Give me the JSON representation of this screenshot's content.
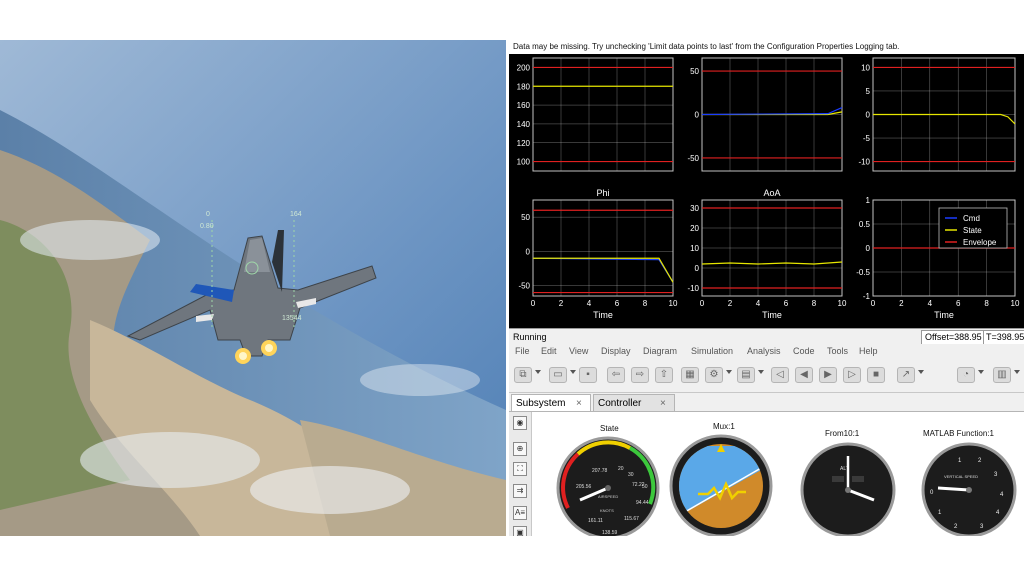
{
  "scope": {
    "warning": "Data may be missing.  Try unchecking 'Limit data points to last' from the Configuration Properties Logging tab.",
    "status": "Running",
    "offset": "Offset=388.95",
    "time": "T=398.950",
    "grid_color": "#d0d0d0",
    "envelope_color": "#e02020",
    "state_color": "#e6e600",
    "cmd_color": "#1a3cff",
    "legend": [
      "Cmd",
      "State",
      "Envelope"
    ],
    "plots": [
      {
        "title": "",
        "xticks": [
          "",
          "",
          "",
          "",
          "",
          ""
        ],
        "yticks": [
          "200",
          "180",
          "160",
          "140",
          "120",
          "100"
        ],
        "xlabel": ""
      },
      {
        "title": "",
        "xticks": [
          "",
          "",
          "",
          "",
          "",
          ""
        ],
        "yticks": [
          "50",
          "0",
          "-50"
        ],
        "xlabel": ""
      },
      {
        "title": "",
        "xticks": [
          "",
          "",
          "",
          "",
          "",
          ""
        ],
        "yticks": [
          "10",
          "5",
          "0",
          "-5",
          "-10"
        ],
        "xlabel": ""
      },
      {
        "title": "Phi",
        "xticks": [
          "0",
          "2",
          "4",
          "6",
          "8",
          "10"
        ],
        "yticks": [
          "50",
          "0",
          "-50"
        ],
        "xlabel": "Time"
      },
      {
        "title": "AoA",
        "xticks": [
          "0",
          "2",
          "4",
          "6",
          "8",
          "10"
        ],
        "yticks": [
          "30",
          "20",
          "10",
          "0",
          "-10"
        ],
        "xlabel": "Time"
      },
      {
        "title": "",
        "xticks": [
          "0",
          "2",
          "4",
          "6",
          "8",
          "10"
        ],
        "yticks": [
          "1",
          "0.5",
          "0",
          "-0.5",
          "-1"
        ],
        "xlabel": "Time"
      }
    ]
  },
  "chart_data": [
    {
      "type": "line",
      "title": "",
      "ylim": [
        90,
        210
      ],
      "xlim": [
        0,
        10
      ],
      "series": [
        {
          "name": "Envelope",
          "x": [
            0,
            10
          ],
          "values": [
            200,
            200
          ]
        },
        {
          "name": "Envelope",
          "x": [
            0,
            10
          ],
          "values": [
            100,
            100
          ]
        },
        {
          "name": "State",
          "x": [
            0,
            10
          ],
          "values": [
            180,
            180
          ]
        }
      ]
    },
    {
      "type": "line",
      "title": "",
      "ylim": [
        -65,
        65
      ],
      "xlim": [
        0,
        10
      ],
      "series": [
        {
          "name": "Envelope",
          "x": [
            0,
            10
          ],
          "values": [
            50,
            50
          ]
        },
        {
          "name": "Envelope",
          "x": [
            0,
            10
          ],
          "values": [
            -50,
            -50
          ]
        },
        {
          "name": "State",
          "x": [
            0,
            9,
            10
          ],
          "values": [
            0,
            0,
            3
          ]
        },
        {
          "name": "Cmd",
          "x": [
            0,
            9,
            10
          ],
          "values": [
            0,
            1,
            8
          ]
        }
      ]
    },
    {
      "type": "line",
      "title": "",
      "ylim": [
        -12,
        12
      ],
      "xlim": [
        0,
        10
      ],
      "series": [
        {
          "name": "Envelope",
          "x": [
            0,
            10
          ],
          "values": [
            10,
            10
          ]
        },
        {
          "name": "Envelope",
          "x": [
            0,
            10
          ],
          "values": [
            -10,
            -10
          ]
        },
        {
          "name": "State",
          "x": [
            0,
            9,
            9.5,
            10
          ],
          "values": [
            0,
            0,
            -0.5,
            -2
          ]
        }
      ]
    },
    {
      "type": "line",
      "title": "Phi",
      "xlabel": "Time",
      "ylim": [
        -65,
        75
      ],
      "xlim": [
        0,
        10
      ],
      "series": [
        {
          "name": "Envelope",
          "x": [
            0,
            10
          ],
          "values": [
            60,
            60
          ]
        },
        {
          "name": "Envelope",
          "x": [
            0,
            10
          ],
          "values": [
            -60,
            -60
          ]
        },
        {
          "name": "Cmd",
          "x": [
            0,
            9,
            10
          ],
          "values": [
            -10,
            -12,
            -45
          ]
        },
        {
          "name": "State",
          "x": [
            0,
            9,
            10
          ],
          "values": [
            -10,
            -10,
            -45
          ]
        }
      ]
    },
    {
      "type": "line",
      "title": "AoA",
      "xlabel": "Time",
      "ylim": [
        -14,
        34
      ],
      "xlim": [
        0,
        10
      ],
      "series": [
        {
          "name": "Envelope",
          "x": [
            0,
            10
          ],
          "values": [
            30,
            30
          ]
        },
        {
          "name": "Envelope",
          "x": [
            0,
            10
          ],
          "values": [
            -10,
            -10
          ]
        },
        {
          "name": "State",
          "x": [
            0,
            2,
            4,
            6,
            8,
            9,
            10
          ],
          "values": [
            2,
            2.5,
            2,
            2.5,
            2,
            2.5,
            3
          ]
        }
      ]
    },
    {
      "type": "line",
      "title": "",
      "xlabel": "Time",
      "ylim": [
        -1,
        1
      ],
      "xlim": [
        0,
        10
      ],
      "series": [
        {
          "name": "Envelope",
          "x": [
            0,
            10
          ],
          "values": [
            0,
            0
          ]
        }
      ]
    }
  ],
  "editor": {
    "menu": [
      "File",
      "Edit",
      "View",
      "Display",
      "Diagram",
      "Simulation",
      "Analysis",
      "Code",
      "Tools",
      "Help"
    ],
    "tabs": [
      "Subsystem",
      "Controller"
    ],
    "tab_close": "×",
    "gauges": [
      {
        "title": "State",
        "label": "AIRSPEED",
        "unit": "KNOTS",
        "readouts": [
          "207.78",
          "205.56",
          "161.11",
          "115.67",
          "94.44",
          "72.22",
          "138.59",
          "20",
          "30",
          "50"
        ]
      },
      {
        "title": "Mux:1"
      },
      {
        "title": "From10:1",
        "label": "ALT"
      },
      {
        "title": "MATLAB Function:1",
        "label": "VERTICAL SPEED",
        "readouts": [
          "1",
          "2",
          "3",
          "4",
          "0",
          "1",
          "2",
          "3",
          "4"
        ]
      }
    ]
  },
  "hud": {
    "left_value": "0",
    "left_sub": "0.80",
    "right_value": "164",
    "right_sub": "13544"
  }
}
